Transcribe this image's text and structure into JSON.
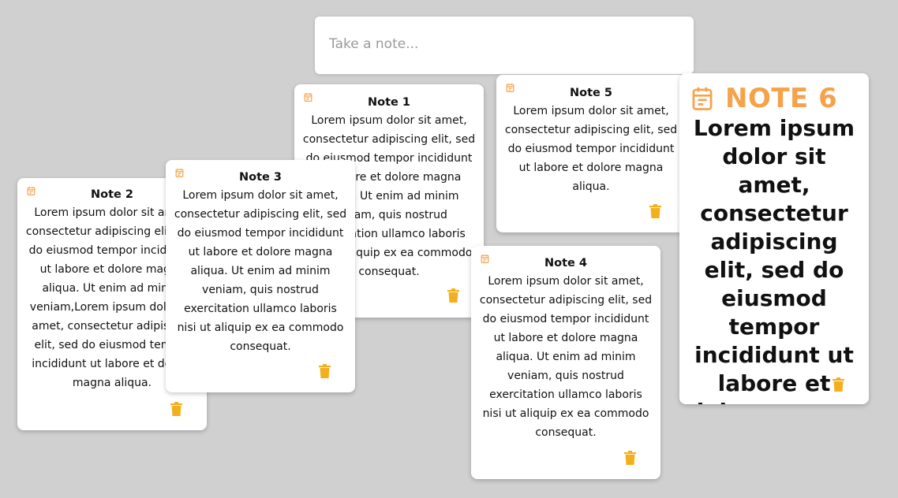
{
  "composer": {
    "placeholder": "Take a note..."
  },
  "colors": {
    "accent": "#f6a24a",
    "trash": "#f2b01e",
    "background": "#d0d0d0"
  },
  "notes": [
    {
      "title": "Note 1",
      "body": "Lorem ipsum dolor sit amet, consectetur adipiscing elit, sed do eiusmod tempor incididunt ut labore et dolore magna aliqua. Ut enim ad minim veniam, quis nostrud exercitation ullamco laboris nisi ut aliquip ex ea commodo consequat.",
      "icon": "notepad-icon",
      "delete_icon": "trash-icon"
    },
    {
      "title": "Note 2",
      "body": "Lorem ipsum dolor sit amet, consectetur adipiscing elit, sed do eiusmod tempor incididunt ut labore et dolore magna aliqua. Ut enim ad minim veniam,Lorem ipsum dolor sit amet, consectetur adipiscing elit, sed do eiusmod tempor incididunt ut labore et dolore magna aliqua.",
      "icon": "notepad-icon",
      "delete_icon": "trash-icon"
    },
    {
      "title": "Note 3",
      "body": "Lorem ipsum dolor sit amet, consectetur adipiscing elit, sed do eiusmod tempor incididunt ut labore et dolore magna aliqua. Ut enim ad minim veniam, quis nostrud exercitation ullamco laboris nisi ut aliquip ex ea commodo consequat.",
      "icon": "notepad-icon",
      "delete_icon": "trash-icon"
    },
    {
      "title": "Note 4",
      "body": "Lorem ipsum dolor sit amet, consectetur adipiscing elit, sed do eiusmod tempor incididunt ut labore et dolore magna aliqua. Ut enim ad minim veniam, quis nostrud exercitation ullamco laboris nisi ut aliquip ex ea commodo consequat.",
      "icon": "notepad-icon",
      "delete_icon": "trash-icon"
    },
    {
      "title": "Note 5",
      "body": "Lorem ipsum dolor sit amet, consectetur adipiscing elit, sed do eiusmod tempor incididunt ut labore et dolore magna aliqua.",
      "icon": "notepad-icon",
      "delete_icon": "trash-icon"
    },
    {
      "title": "NOTE 6",
      "body": "Lorem ipsum dolor sit amet, consectetur adipiscing elit, sed do eiusmod tempor incididunt ut labore et dolore magna aliqua.",
      "icon": "notepad-icon",
      "delete_icon": "trash-icon"
    }
  ]
}
